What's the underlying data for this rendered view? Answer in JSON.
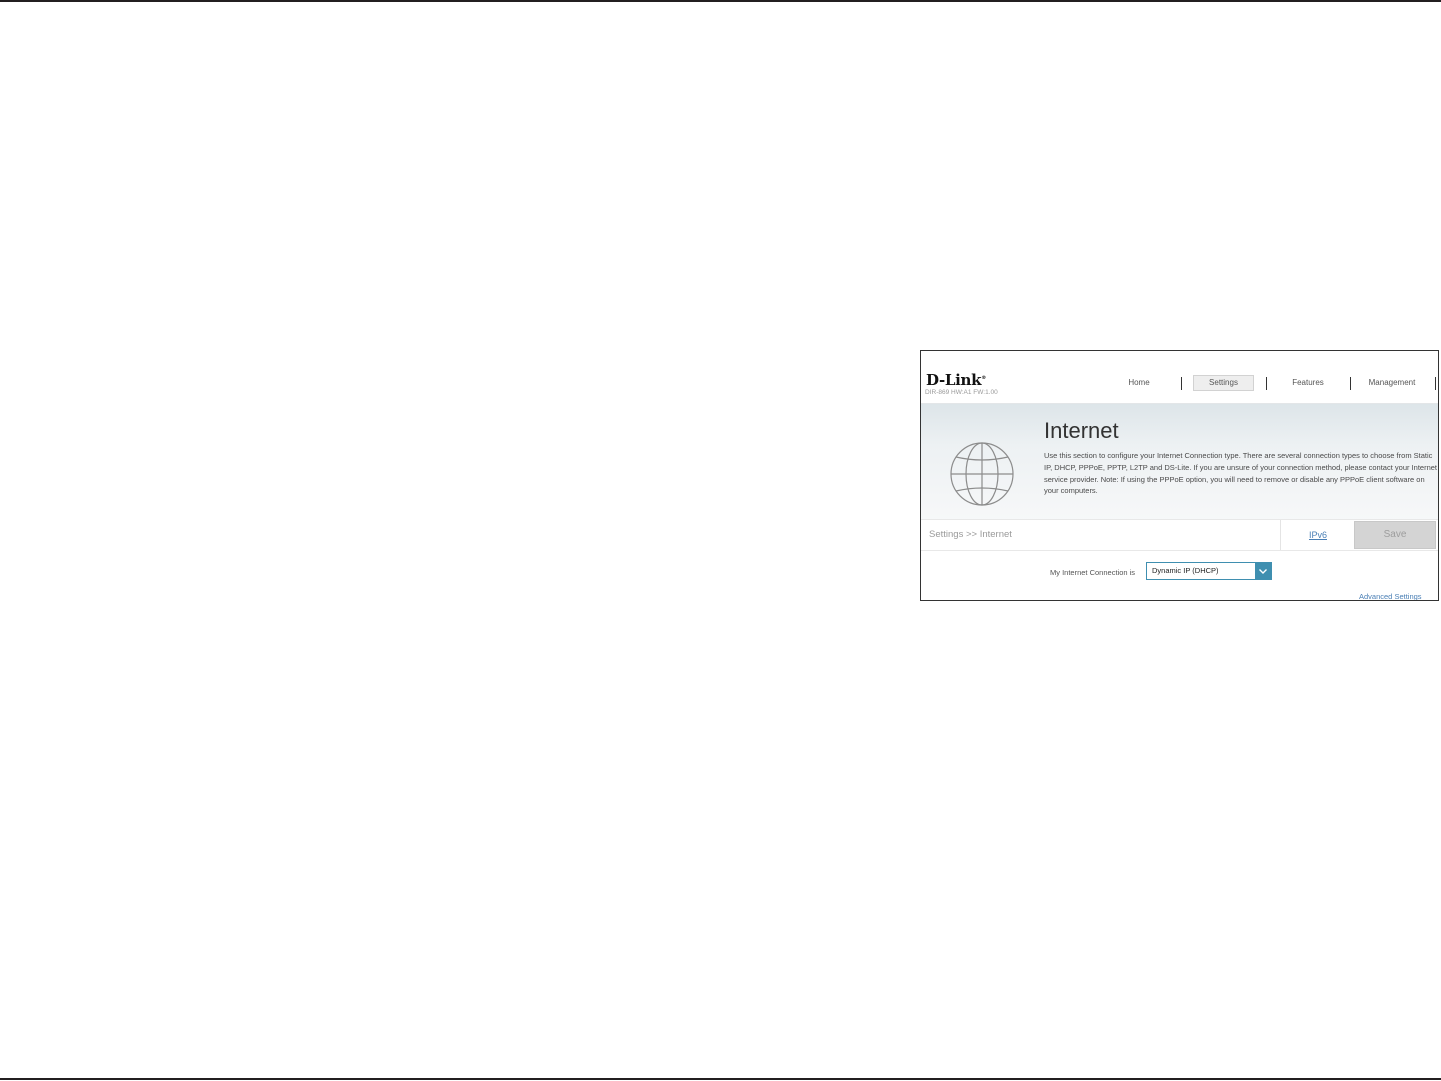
{
  "header": {
    "logo": "D-Link",
    "model": "DIR-869 HW:A1 FW:1.00",
    "nav": [
      {
        "label": "Home"
      },
      {
        "label": "Settings"
      },
      {
        "label": "Features"
      },
      {
        "label": "Management"
      }
    ],
    "active_nav": "Settings"
  },
  "banner": {
    "icon": "globe-icon",
    "title": "Internet",
    "description": "Use this section to configure your Internet Connection type. There are several connection types to choose from Static IP, DHCP, PPPoE, PPTP, L2TP and DS-Lite. If you are unsure of your connection method, please contact your Internet service provider. Note: If using the PPPoE option, you will need to remove or disable any PPPoE client software on your computers."
  },
  "toolbar": {
    "breadcrumb": "Settings >> Internet",
    "ipv6_link": "IPv6",
    "save_label": "Save"
  },
  "connection": {
    "label": "My Internet Connection is",
    "selected": "Dynamic IP (DHCP)"
  },
  "advanced_link": "Advanced Settings",
  "colors": {
    "accent": "#3f8fb0",
    "link": "#4a7fb5",
    "save_bg": "#d4d4d4"
  }
}
